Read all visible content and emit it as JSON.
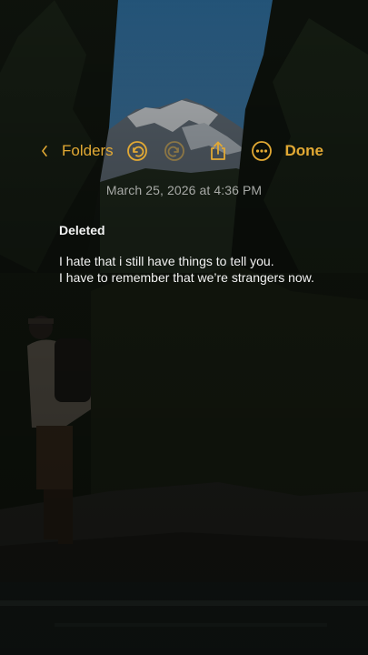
{
  "nav": {
    "back_label": "Folders",
    "done_label": "Done"
  },
  "icons": {
    "back": "chevron-left-icon",
    "undo": "undo-icon",
    "redo": "redo-icon",
    "share": "share-icon",
    "more": "ellipsis-circle-icon"
  },
  "note": {
    "date": "March 25, 2026 at 4:36 PM",
    "title": "Deleted",
    "lines": [
      "I hate that i still have things to tell you.",
      "I have to remember that we’re strangers now."
    ]
  },
  "colors": {
    "accent": "#e2a934",
    "date_text": "#a7a9a6",
    "note_text": "#f2f2f2",
    "sky": "#3a7cb0"
  }
}
